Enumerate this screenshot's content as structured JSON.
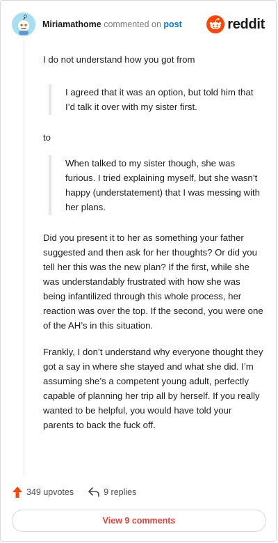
{
  "header": {
    "author": "Miriamathome",
    "meta_text": "commented on",
    "post_link": "post",
    "brand": "reddit"
  },
  "comment": {
    "intro": "I do not understand how you got from",
    "quote_1": "I agreed that it was an option, but told him that I’d talk it over with my sister first.",
    "connector": "to",
    "quote_2": "When talked to my sister though, she was furious. I tried explaining myself, but she wasn’t happy (understatement) that I was messing with her plans.",
    "paragraph_1": "Did you present it to her as something your father suggested and then ask for her thoughts? Or did you tell her this was the new plan? If the first, while she was understandably frustrated with how she was being infantilized through this whole process, her reaction was over the top. If the second, you were one of the AH’s in this situation.",
    "paragraph_2": "Frankly, I don’t understand why everyone thought they got a say in where she stayed and what she did. I’m assuming she’s a competent young adult, perfectly capable of planning her trip all by herself. If you really wanted to be helpful, you would have told your parents to back the fuck off."
  },
  "actions": {
    "upvotes": "349 upvotes",
    "replies": "9 replies"
  },
  "footer": {
    "view_comments": "View 9 comments"
  },
  "colors": {
    "accent": "#ff4500",
    "link": "#0079d3",
    "button_text": "#e0433a"
  },
  "icons": {
    "avatar": "snoo-avatar-icon",
    "brand": "reddit-logo-icon",
    "upvote": "upvote-arrow-icon",
    "reply": "reply-arrow-icon"
  }
}
